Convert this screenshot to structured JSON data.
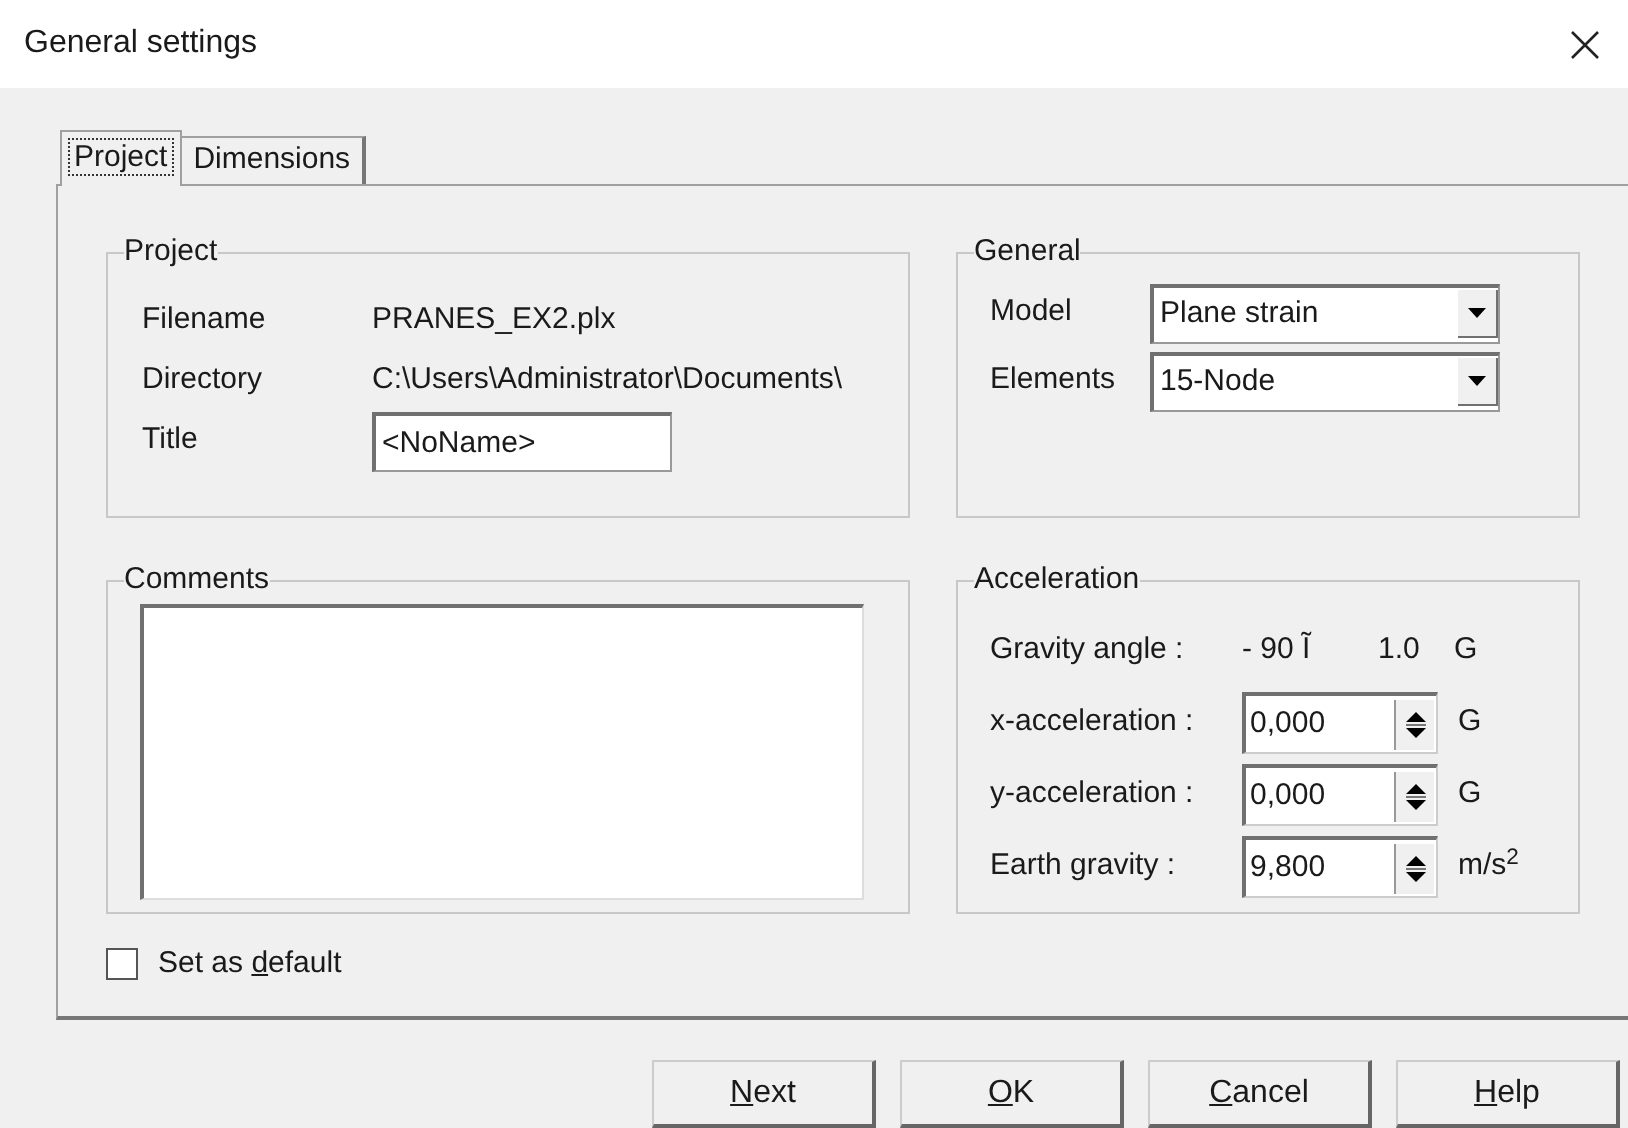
{
  "window": {
    "title": "General settings"
  },
  "tabs": [
    {
      "label": "Project",
      "selected": true
    },
    {
      "label": "Dimensions",
      "selected": false
    }
  ],
  "project": {
    "title": "Project",
    "rows": [
      {
        "kind": "text",
        "label": "Filename",
        "value": "PRANES_EX2.plx"
      },
      {
        "kind": "text",
        "label": "Directory",
        "value": "C:\\Users\\Administrator\\Documents\\"
      },
      {
        "kind": "field",
        "label": "Title",
        "value": "<NoName>"
      }
    ]
  },
  "comments": {
    "title": "Comments"
  },
  "general": {
    "title": "General",
    "rows": [
      {
        "label": "Model",
        "value": "Plane strain"
      },
      {
        "label": "Elements",
        "value": "15-Node"
      }
    ]
  },
  "acceleration": {
    "title": "Acceleration",
    "rows": [
      {
        "kind": "text",
        "label": "Gravity angle :",
        "value": "- 90 Ĩ",
        "extra": "1.0",
        "unit": "G"
      },
      {
        "kind": "spin",
        "label": "x-acceleration :",
        "value": "0,000",
        "unit": "G"
      },
      {
        "kind": "spin",
        "label": "y-acceleration :",
        "value": "0,000",
        "unit": "G"
      },
      {
        "kind": "spin",
        "label": "Earth gravity :",
        "value": "9,800",
        "unit": "m/s$^{2}$"
      }
    ]
  },
  "set_as_default": {
    "before": "Set as ",
    "key": "d",
    "after": "efault",
    "checked": false
  },
  "buttons": [
    {
      "key": "N",
      "after": "ext"
    },
    {
      "key": "O",
      "after": "K"
    },
    {
      "key": "C",
      "after": "ancel"
    },
    {
      "key": "H",
      "after": "elp"
    }
  ]
}
